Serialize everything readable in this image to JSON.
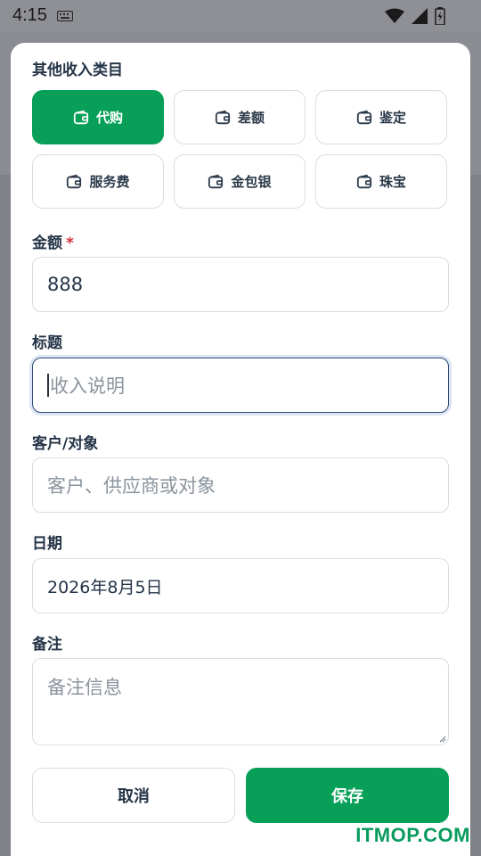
{
  "status_bar": {
    "time": "4:15",
    "icons": [
      "keyboard-icon",
      "wifi-icon",
      "signal-icon",
      "battery-icon"
    ]
  },
  "category_section": {
    "title": "其他收入类目",
    "selected_index": 0,
    "items": [
      {
        "label": "代购",
        "icon": "wallet-icon"
      },
      {
        "label": "差额",
        "icon": "wallet-icon"
      },
      {
        "label": "鉴定",
        "icon": "wallet-icon"
      },
      {
        "label": "服务费",
        "icon": "wallet-icon"
      },
      {
        "label": "金包银",
        "icon": "wallet-icon"
      },
      {
        "label": "珠宝",
        "icon": "wallet-icon"
      }
    ]
  },
  "amount": {
    "label": "金额",
    "required_mark": "*",
    "value": "888"
  },
  "title_field": {
    "label": "标题",
    "placeholder": "收入说明"
  },
  "customer": {
    "label": "客户/对象",
    "placeholder": "客户、供应商或对象"
  },
  "date": {
    "label": "日期",
    "value": "2026年8月5日"
  },
  "note": {
    "label": "备注",
    "placeholder": "备注信息"
  },
  "actions": {
    "cancel_label": "取消",
    "save_label": "保存"
  },
  "watermark": "ITMOP.COM",
  "colors": {
    "accent": "#08a058",
    "required": "#d32f2f",
    "border": "#d9dde2",
    "focus_border": "#2f4a73"
  }
}
